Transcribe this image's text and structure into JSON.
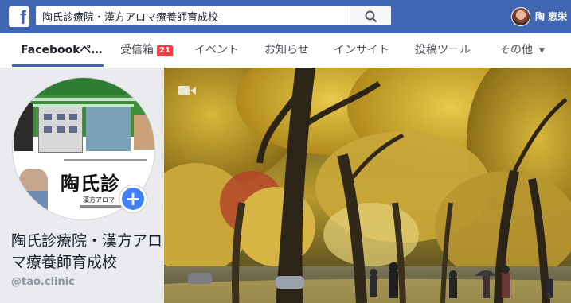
{
  "header": {
    "logo_letter": "f",
    "search_value": "陶氏診療院・漢方アロマ療養師育成校",
    "user_name": "陶 恵栄"
  },
  "tabs": [
    {
      "label": "Facebookペ…",
      "active": true
    },
    {
      "label": "受信箱",
      "badge": "21"
    },
    {
      "label": "イベント"
    },
    {
      "label": "お知らせ"
    },
    {
      "label": "インサイト"
    },
    {
      "label": "投稿ツール"
    },
    {
      "label": "その他",
      "caret": "▼"
    }
  ],
  "profile": {
    "page_name": "陶氏診療院・漢方アロマ療養師育成校",
    "handle": "@tao.clinic",
    "photo_sign": "陶氏診",
    "photo_sub": "漢方アロマ",
    "add_icon": "plus-icon"
  },
  "cover": {
    "icon": "video-camera-icon"
  },
  "colors": {
    "brand": "#4267b2",
    "badge": "#fa3e3e",
    "add_button": "#4080ff"
  }
}
